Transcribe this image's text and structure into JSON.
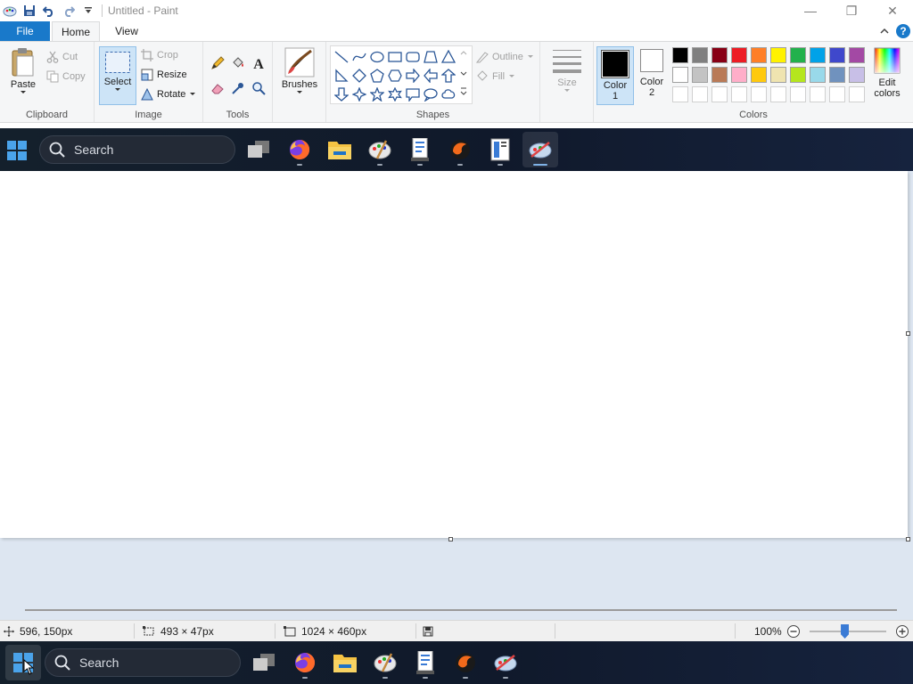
{
  "window": {
    "title": "Untitled - Paint"
  },
  "tabs": {
    "file": "File",
    "home": "Home",
    "view": "View"
  },
  "clipboard": {
    "paste": "Paste",
    "cut": "Cut",
    "copy": "Copy",
    "label": "Clipboard"
  },
  "image": {
    "select": "Select",
    "crop": "Crop",
    "resize": "Resize",
    "rotate": "Rotate",
    "label": "Image"
  },
  "tools": {
    "label": "Tools"
  },
  "brushes": {
    "label": "Brushes"
  },
  "shapes": {
    "outline": "Outline",
    "fill": "Fill",
    "label": "Shapes"
  },
  "size": {
    "label": "Size"
  },
  "colors": {
    "color1_label": "Color",
    "color1_num": "1",
    "color2_label": "Color",
    "color2_num": "2",
    "edit_label": "Edit",
    "edit_label2": "colors",
    "label": "Colors",
    "color1": "#000000",
    "color2": "#ffffff",
    "row1": [
      "#000000",
      "#7f7f7f",
      "#880015",
      "#ed1c24",
      "#ff7f27",
      "#fff200",
      "#22b14c",
      "#00a2e8",
      "#3f48cc",
      "#a349a4"
    ],
    "row2": [
      "#ffffff",
      "#c3c3c3",
      "#b97a57",
      "#ffaec9",
      "#ffc90e",
      "#efe4b0",
      "#b5e61d",
      "#99d9ea",
      "#7092be",
      "#c8bfe7"
    ]
  },
  "taskbar": {
    "search_placeholder": "Search"
  },
  "status": {
    "cursor": "596, 150px",
    "selection": "493 × 47px",
    "canvas_size": "1024 × 460px",
    "zoom": "100%",
    "zoom_fraction": 0.46
  }
}
